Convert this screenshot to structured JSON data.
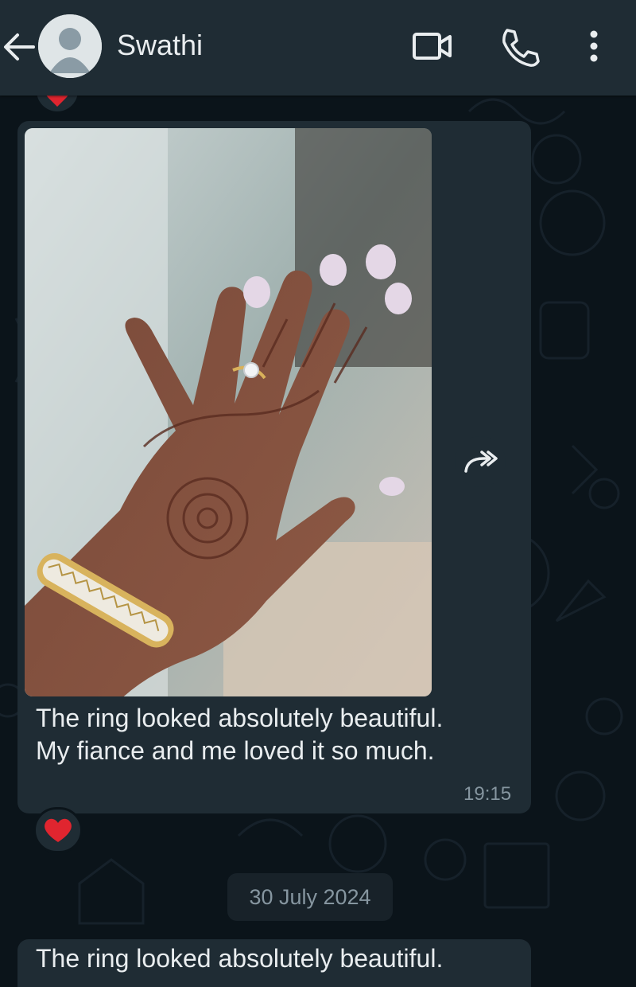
{
  "header": {
    "contact_name": "Swathi",
    "back_icon": "arrow-left-icon",
    "avatar_icon": "default-avatar-icon",
    "video_icon": "video-camera-icon",
    "call_icon": "phone-icon",
    "menu_icon": "more-vertical-icon"
  },
  "messages": [
    {
      "type": "image",
      "image_description": "hand-with-ring-photo",
      "text": "The ring looked absolutely beautiful.\nMy fiance and me loved it so much.",
      "time": "19:15",
      "reaction": "❤️"
    }
  ],
  "date_separator": "30 July 2024",
  "next_message_preview": "The ring looked absolutely beautiful.",
  "forward_icon": "forward-icon",
  "colors": {
    "background": "#0b141a",
    "header": "#1f2c34",
    "bubble": "#1f2c34",
    "timestamp": "#8696a0",
    "heart": "#e0252f"
  }
}
